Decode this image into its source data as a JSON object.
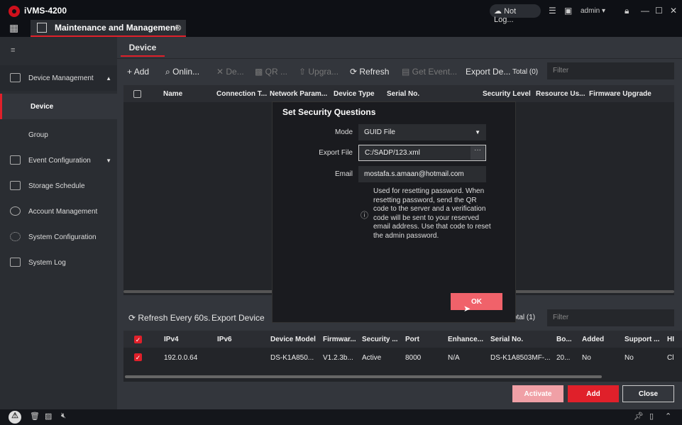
{
  "app": {
    "title": "iVMS-4200",
    "cloud_status": "Not Log...",
    "user": "admin"
  },
  "tabs": [
    {
      "label": "Maintenance and Management"
    }
  ],
  "sidebar": {
    "items": [
      {
        "label": "Device Management",
        "icon": "device-icon"
      },
      {
        "label": "Device"
      },
      {
        "label": "Group"
      },
      {
        "label": "Event Configuration",
        "icon": "event-icon"
      },
      {
        "label": "Storage Schedule",
        "icon": "storage-icon"
      },
      {
        "label": "Account Management",
        "icon": "account-icon"
      },
      {
        "label": "System Configuration",
        "icon": "gear-icon"
      },
      {
        "label": "System Log",
        "icon": "log-icon"
      }
    ]
  },
  "subtab": "Device",
  "toolbar": {
    "add": "Add",
    "online": "Onlin...",
    "delete": "De...",
    "qr": "QR ...",
    "upgrade": "Upgra...",
    "refresh": "Refresh",
    "get_event": "Get Event...",
    "export": "Export De...",
    "total": "Total (0)",
    "filter_placeholder": "Filter"
  },
  "device_table": {
    "columns": [
      "Name",
      "Connection T...",
      "Network Param...",
      "Device Type",
      "Serial No.",
      "Security Level",
      "Resource Us...",
      "Firmware Upgrade"
    ]
  },
  "online": {
    "refresh": "Refresh Every 60s.",
    "export": "Export Device",
    "total": "Total (1)",
    "filter_placeholder": "Filter",
    "columns": [
      "IPv4",
      "IPv6",
      "Device Model",
      "Firmwar...",
      "Security ...",
      "Port",
      "Enhance...",
      "Serial No.",
      "Bo...",
      "Added",
      "Support ...",
      "HI"
    ],
    "rows": [
      {
        "checked": true,
        "cells": [
          "192.0.0.64",
          "",
          "DS-K1A850...",
          "V1.2.3b...",
          "Active",
          "8000",
          "N/A",
          "DS-K1A8503MF-...",
          "20...",
          "No",
          "No",
          "Cl"
        ]
      }
    ],
    "activate": "Activate",
    "add": "Add",
    "close": "Close"
  },
  "dialog": {
    "title": "Set Security Questions",
    "mode_label": "Mode",
    "mode_value": "GUID File",
    "export_label": "Export File",
    "export_value": "C:/SADP/123.xml",
    "email_label": "Email",
    "email_value": "mostafa.s.amaan@hotmail.com",
    "hint": "Used for resetting password. When resetting password, send the QR code to the server and a verification code will be sent to your reserved email address. Use that code to reset the admin password.",
    "ok": "OK"
  },
  "colors": {
    "accent": "#e0202a",
    "ok_button": "#f0626a",
    "activate_disabled": "#f0a0a6"
  }
}
